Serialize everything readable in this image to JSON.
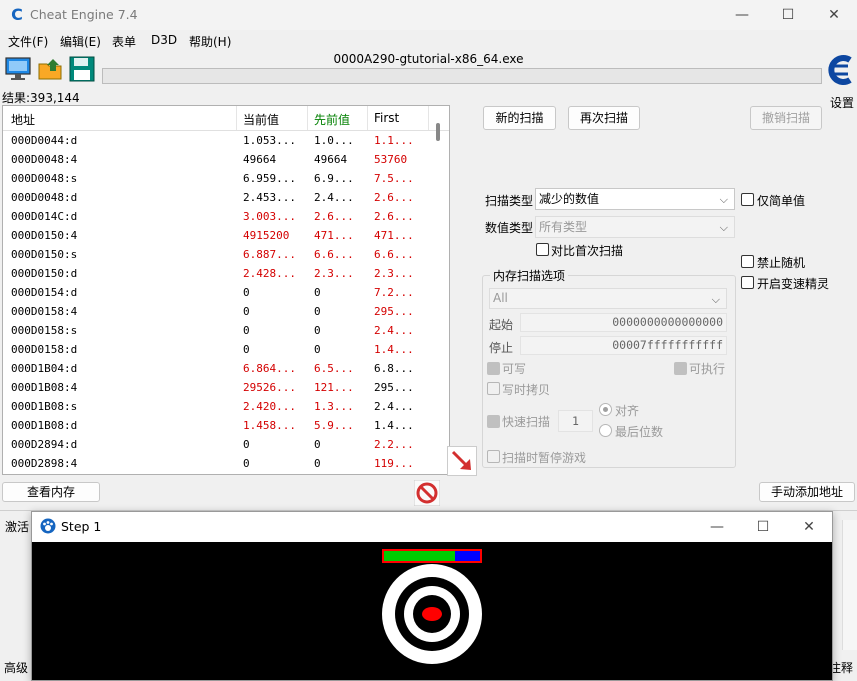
{
  "window": {
    "title": "Cheat Engine 7.4",
    "minimize": "—",
    "maximize": "☐",
    "close": "✕"
  },
  "menu": [
    "文件(F)",
    "编辑(E)",
    "表单",
    "D3D",
    "帮助(H)"
  ],
  "toolbar": {
    "process_title": "0000A290-gtutorial-x86_64.exe",
    "settings_label": "设置",
    "progress_percent": 0
  },
  "results": {
    "count_label": "结果:393,144",
    "columns": {
      "address": "地址",
      "current": "当前值",
      "previous": "先前值",
      "first": "First"
    },
    "colors": {
      "previous_header": "#008000",
      "changed": "#d40000"
    },
    "rows": [
      {
        "address": "000D0044:d",
        "current": "1.053...",
        "previous": "1.0...",
        "first": "1.1...",
        "changed": false,
        "first_changed": true
      },
      {
        "address": "000D0048:4",
        "current": "49664",
        "previous": "49664",
        "first": "53760",
        "changed": false,
        "first_changed": true
      },
      {
        "address": "000D0048:s",
        "current": "6.959...",
        "previous": "6.9...",
        "first": "7.5...",
        "changed": false,
        "first_changed": true
      },
      {
        "address": "000D0048:d",
        "current": "2.453...",
        "previous": "2.4...",
        "first": "2.6...",
        "changed": false,
        "first_changed": true
      },
      {
        "address": "000D014C:d",
        "current": "3.003...",
        "previous": "2.6...",
        "first": "2.6...",
        "changed": true,
        "first_changed": true
      },
      {
        "address": "000D0150:4",
        "current": "4915200",
        "previous": "471...",
        "first": "471...",
        "changed": true,
        "first_changed": true
      },
      {
        "address": "000D0150:s",
        "current": "6.887...",
        "previous": "6.6...",
        "first": "6.6...",
        "changed": true,
        "first_changed": true
      },
      {
        "address": "000D0150:d",
        "current": "2.428...",
        "previous": "2.3...",
        "first": "2.3...",
        "changed": true,
        "first_changed": true
      },
      {
        "address": "000D0154:d",
        "current": "0",
        "previous": "0",
        "first": "7.2...",
        "changed": false,
        "first_changed": true
      },
      {
        "address": "000D0158:4",
        "current": "0",
        "previous": "0",
        "first": "295...",
        "changed": false,
        "first_changed": true
      },
      {
        "address": "000D0158:s",
        "current": "0",
        "previous": "0",
        "first": "2.4...",
        "changed": false,
        "first_changed": true
      },
      {
        "address": "000D0158:d",
        "current": "0",
        "previous": "0",
        "first": "1.4...",
        "changed": false,
        "first_changed": true
      },
      {
        "address": "000D1B04:d",
        "current": "6.864...",
        "previous": "6.5...",
        "first": "6.8...",
        "changed": true,
        "first_changed": false
      },
      {
        "address": "000D1B08:4",
        "current": "29526...",
        "previous": "121...",
        "first": "295...",
        "changed": true,
        "first_changed": false
      },
      {
        "address": "000D1B08:s",
        "current": "2.420...",
        "previous": "1.3...",
        "first": "2.4...",
        "changed": true,
        "first_changed": false
      },
      {
        "address": "000D1B08:d",
        "current": "1.458...",
        "previous": "5.9...",
        "first": "1.4...",
        "changed": true,
        "first_changed": false
      },
      {
        "address": "000D2894:d",
        "current": "0",
        "previous": "0",
        "first": "2.2...",
        "changed": false,
        "first_changed": true
      },
      {
        "address": "000D2898:4",
        "current": "0",
        "previous": "0",
        "first": "119...",
        "changed": false,
        "first_changed": true
      }
    ]
  },
  "scan": {
    "new_scan": "新的扫描",
    "next_scan": "再次扫描",
    "undo_scan": "撤销扫描",
    "scan_type_label": "扫描类型",
    "scan_type_value": "减少的数值",
    "value_type_label": "数值类型",
    "value_type_value": "所有类型",
    "compare_first": "对比首次扫描",
    "simple_values": "仅简单值",
    "disable_random": "禁止随机",
    "speedhack": "开启变速精灵"
  },
  "memory": {
    "group_title": "内存扫描选项",
    "region": "All",
    "start_label": "起始",
    "start_value": "0000000000000000",
    "stop_label": "停止",
    "stop_value": "00007fffffffffff",
    "writable": "可写",
    "executable": "可执行",
    "copy_on_write": "写时拷贝",
    "fast_scan": "快速扫描",
    "fast_scan_value": "1",
    "align": "对齐",
    "last_digits": "最后位数",
    "pause_game": "扫描时暂停游戏"
  },
  "bottom": {
    "view_memory": "查看内存",
    "add_address": "手动添加地址",
    "activate_label": "激活",
    "advanced_label": "高级",
    "comment_label": "注释"
  },
  "step": {
    "title": "Step 1",
    "health_fraction": 0.74,
    "colors": {
      "health": "#00cc00",
      "remaining": "#0000ff",
      "border": "#ff0000",
      "target_center": "#ff0000"
    }
  }
}
